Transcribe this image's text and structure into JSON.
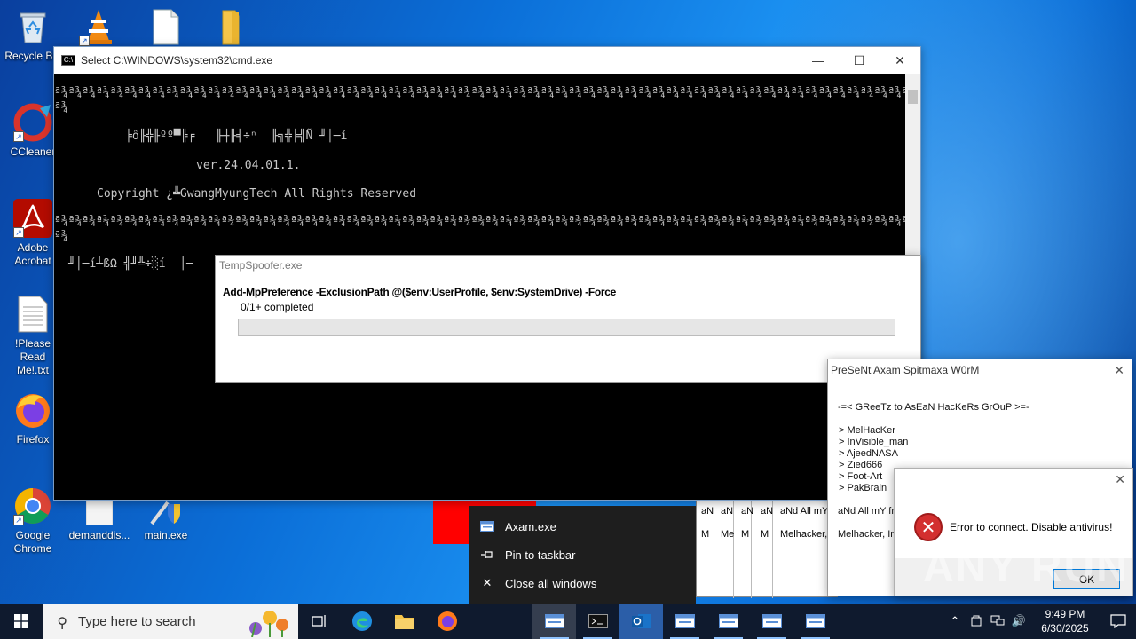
{
  "desktop_icons": [
    {
      "label": "Recycle Bin"
    },
    {
      "label": "CCleaner"
    },
    {
      "label": "Adobe Acrobat"
    },
    {
      "label": "!Please Read Me!.txt"
    },
    {
      "label": "Firefox"
    },
    {
      "label": "Google Chrome"
    },
    {
      "label": "demanddis..."
    },
    {
      "label": "main.exe"
    }
  ],
  "cmd": {
    "title": "Select C:\\WINDOWS\\system32\\cmd.exe",
    "separator": "ª¾ª¾ª¾ª¾ª¾ª¾ª¾ª¾ª¾ª¾ª¾ª¾ª¾ª¾ª¾ª¾ª¾ª¾ª¾ª¾ª¾ª¾ª¾ª¾ª¾ª¾ª¾ª¾ª¾ª¾ª¾ª¾ª¾ª¾ª¾ª¾ª¾ª¾ª¾ª¾ª¾ª¾ª¾ª¾ª¾ª¾ª¾ª¾ª¾ª¾ª¾ª¾ª¾ª¾ª¾ª¾ª¾ª¾ª¾ª¾ª¾ª¾ª¾ª¾ª¾ª¾ª¾ª¾ª¾ª¾ª¾ª¾ª¾ª¾ª¾ª¾ª¾ª¾ª¾ª¾ª¾ª¾ª¾ª¾ª¾ª¾ª¾ª¾ª¾ª¾ª¾ª¾ª¾ª¾ª¾ª¾ª¾ª¾ª¾ª¾ª¾ª¾ª¾ª¾ª¾ª¾ª¾ª¾ª¾ª¾ª¾ª¾ª¾ª¾ª¾ª¾ª¾ª¾ª¾ª¾ª¾ª¾ª¾ª¾ª¾ª¾ª¾ª¾ª¾ª¾ª¾ª¾ª¾ª¾ª¾ª¾",
    "separator_tail": "ª¾",
    "garbled_title": "╞ô╟╬╟ºº▀╠╒   ╟╫╟╡÷ⁿ  ╟╗╬╞╣Ñ ╜│─í",
    "version": "ver.24.04.01.1.",
    "copyright": "Copyright ¿╩GwangMyungTech All Rights Reserved",
    "garbled_status": "╜│─í┴ßΩ ╣╜╩÷░í  │─"
  },
  "spoofer": {
    "title": "TempSpoofer.exe",
    "command": "Add-MpPreference -ExclusionPath @($env:UserProfile, $env:SystemDrive) -Force",
    "progress_text": "0/1+ completed",
    "progress": 0
  },
  "worm": {
    "title": "PreSeNt Axam Spitmaxa W0rM",
    "greet": "-=< GReeTz to AsEaN HacKeRs GrOuP >=-",
    "names": [
      "> MelHacKer",
      "> InVisible_man",
      "> AjeedNASA",
      "> Zied666",
      "> Foot-Art",
      "> PakBrain"
    ],
    "footer1": "aNd All mY fr",
    "footer2": "Melhacker, In"
  },
  "stacked_windows": {
    "line1": [
      "aN",
      "aN",
      "aN",
      "aN",
      "aNd All mY"
    ],
    "line2": [
      "M",
      "Me",
      "M",
      "M",
      "Melhacker,"
    ]
  },
  "error_dialog": {
    "message": "Error to connect. Disable antivirus!",
    "ok_label": "OK"
  },
  "jump_list": {
    "items": [
      "Axam.exe",
      "Pin to taskbar",
      "Close all windows"
    ]
  },
  "taskbar": {
    "search_placeholder": "Type here to search",
    "time": "9:49 PM",
    "date": "6/30/2025"
  },
  "watermark": "ANY RUN"
}
